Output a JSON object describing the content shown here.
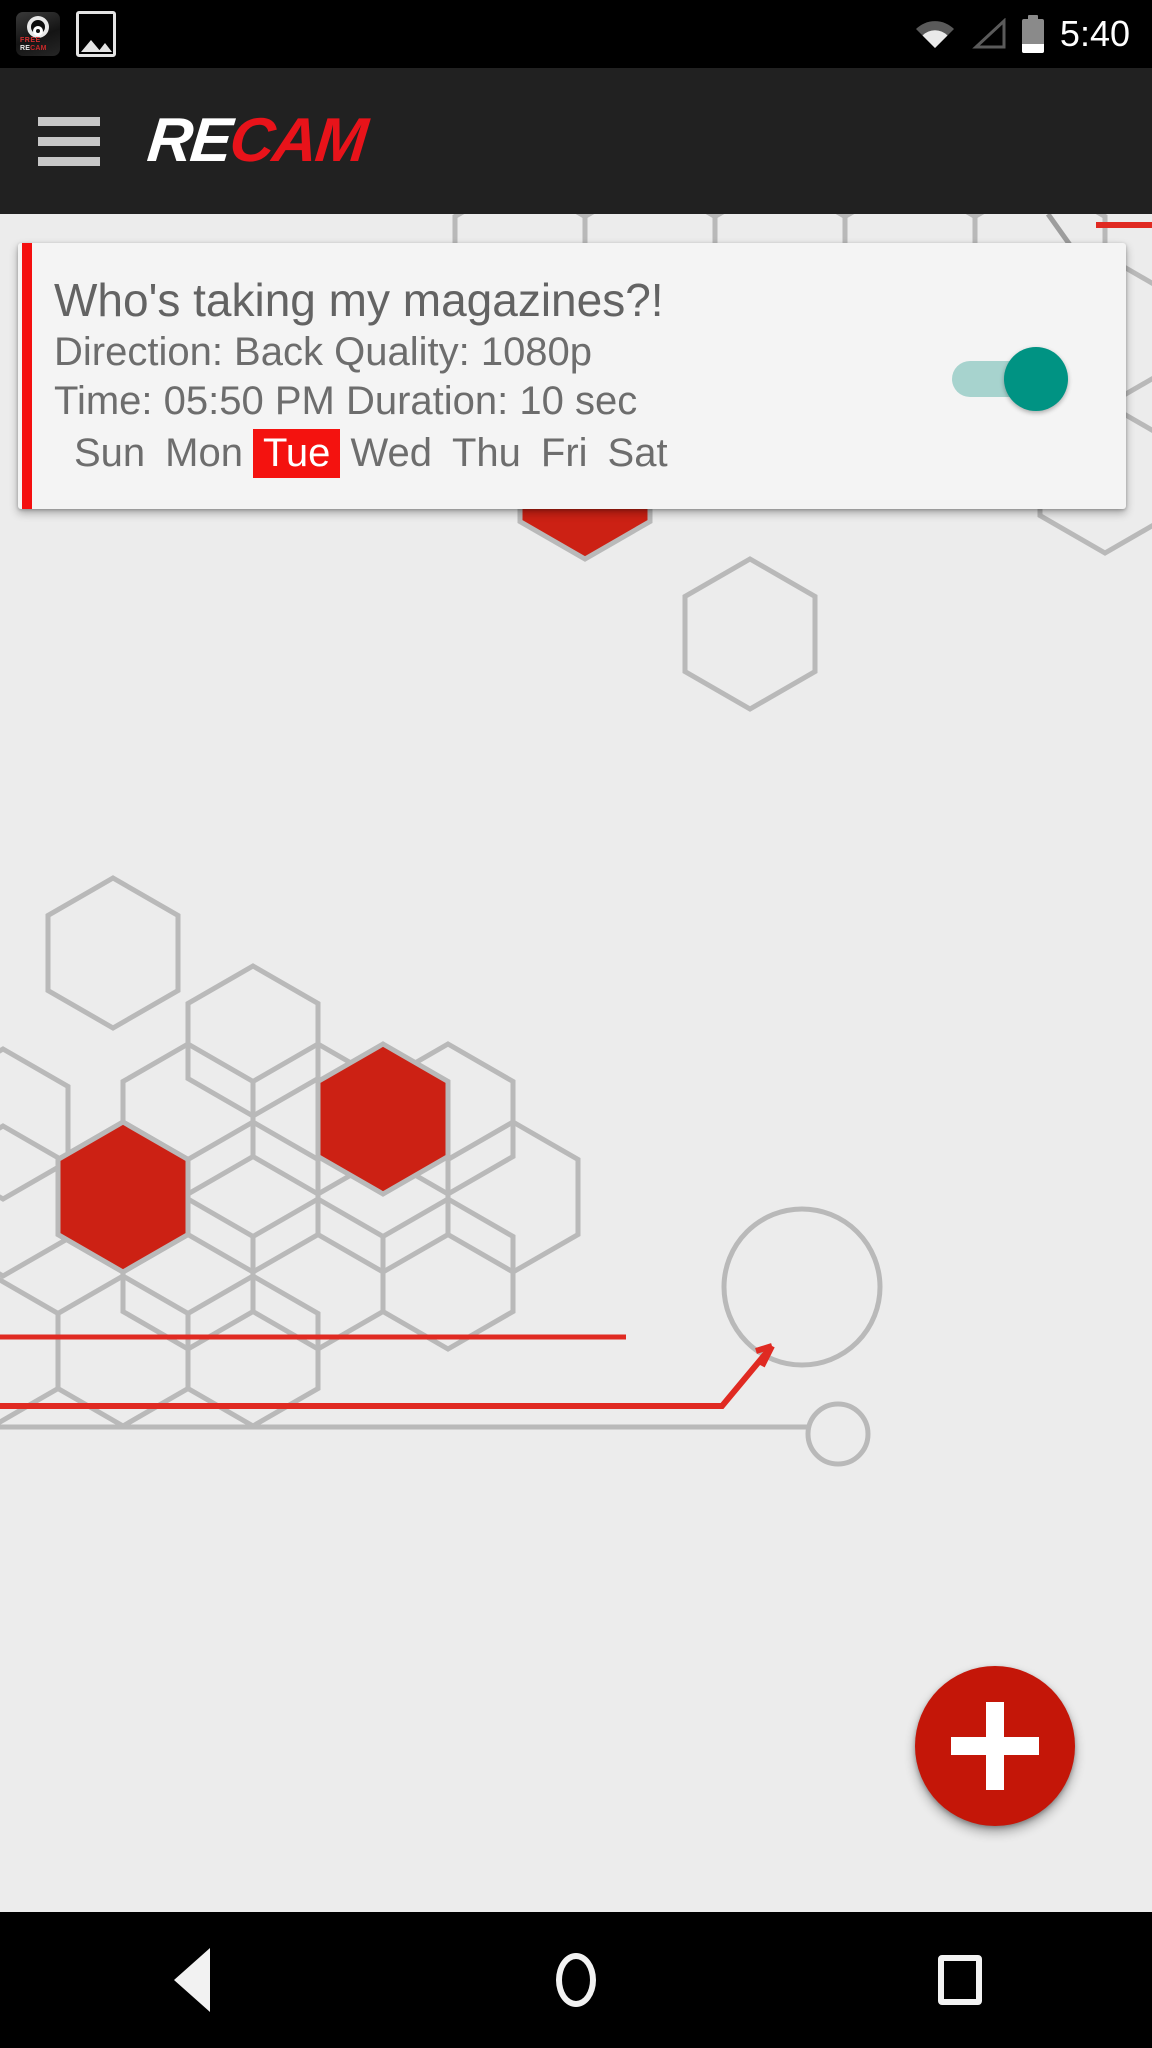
{
  "status_bar": {
    "time": "5:40",
    "notification_icons": [
      "recam-app-icon",
      "photo-gallery-icon"
    ],
    "system_icons": [
      "wifi-icon",
      "cellular-signal-icon",
      "battery-icon"
    ],
    "app_icon_labels": {
      "free": "FREE",
      "re": "RE",
      "cam": "CAM"
    }
  },
  "app_bar": {
    "menu_label": "menu-icon",
    "brand_first": "RE",
    "brand_second": "CAM",
    "background_color": "#212121",
    "brand_accent_color": "#e8131a"
  },
  "card": {
    "title": "Who's taking my magazines?!",
    "details_line": "Direction: Back  Quality: 1080p",
    "direction_label": "Direction:",
    "direction_value": "Back",
    "quality_label": "Quality:",
    "quality_value": "1080p",
    "time_line": "Time: 05:50 PM  Duration: 10 sec",
    "time_label": "Time:",
    "time_value": "05:50 PM",
    "duration_label": "Duration:",
    "duration_value": "10 sec",
    "days": [
      {
        "label": "Sun",
        "selected": false
      },
      {
        "label": "Mon",
        "selected": false
      },
      {
        "label": "Tue",
        "selected": true
      },
      {
        "label": "Wed",
        "selected": false
      },
      {
        "label": "Thu",
        "selected": false
      },
      {
        "label": "Fri",
        "selected": false
      },
      {
        "label": "Sat",
        "selected": false
      }
    ],
    "toggle": {
      "name": "schedule-enabled-toggle",
      "state": "on"
    },
    "accent_color": "#f40f0f",
    "selected_day_color": "#f4120f",
    "toggle_on_color": "#009383"
  },
  "fab": {
    "label": "+",
    "name": "add-recording-button",
    "color": "#c41608"
  },
  "nav_bar": {
    "back": "back-button",
    "home": "home-button",
    "recents": "recents-button"
  },
  "theme": {
    "page_background": "#ececec",
    "hex_outline": "#b9b9b9",
    "hex_red": "#cc2114",
    "line_red": "#e02a22"
  }
}
